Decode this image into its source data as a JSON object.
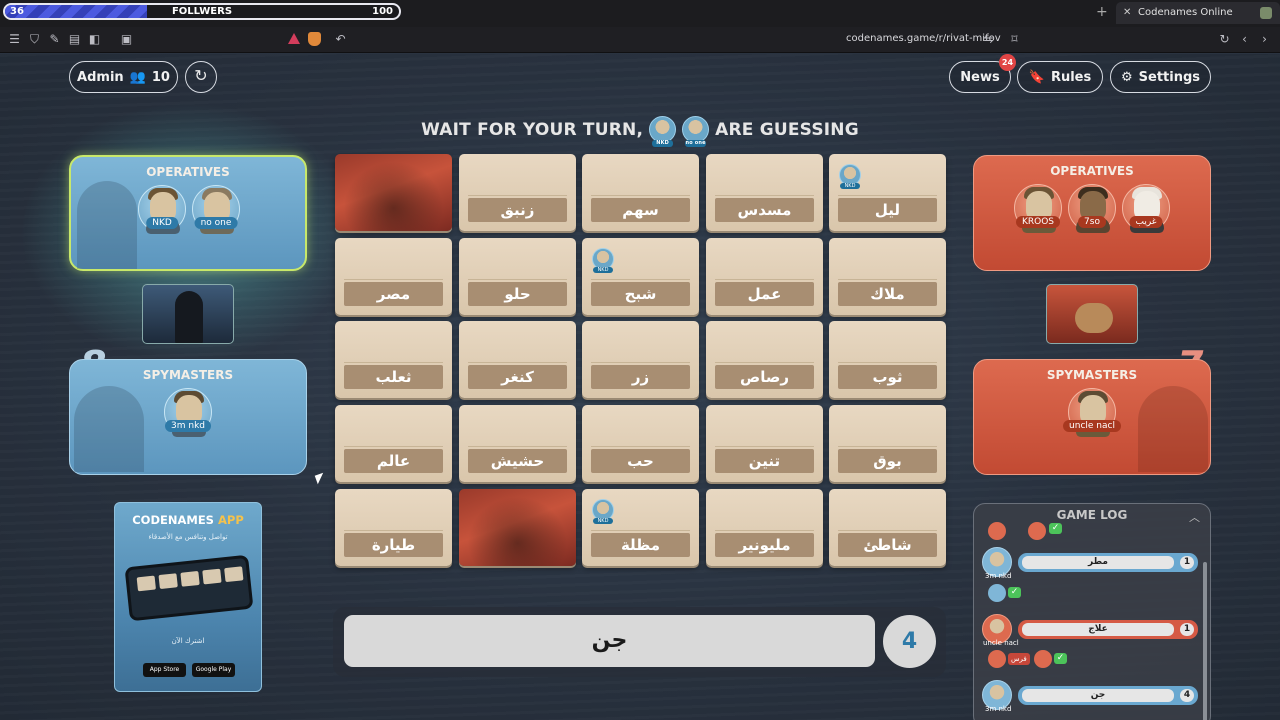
{
  "stream": {
    "followers_current": "36",
    "followers_label": "FOLLWERS",
    "followers_goal": "100",
    "progress_fraction": 0.36
  },
  "browser": {
    "tab_title": "Codenames Online",
    "url": "codenames.game/r/rivat-mifov"
  },
  "header": {
    "admin_label": "Admin",
    "player_count": "10",
    "news_label": "News",
    "news_badge": "24",
    "rules_label": "Rules",
    "settings_label": "Settings"
  },
  "banner": {
    "prefix": "WAIT FOR YOUR TURN,",
    "suffix": "ARE GUESSING",
    "guessers": [
      "NKD",
      "no one"
    ]
  },
  "blue_team": {
    "score": "8",
    "operatives_title": "OPERATIVES",
    "operatives": [
      "NKD",
      "no one"
    ],
    "spymasters_title": "SPYMASTERS",
    "spymasters": [
      "3m nkd"
    ]
  },
  "red_team": {
    "score": "7",
    "operatives_title": "OPERATIVES",
    "operatives": [
      "KROOS",
      "7so",
      "غريب"
    ],
    "spymasters_title": "SPYMASTERS",
    "spymasters": [
      "uncle nacl"
    ]
  },
  "board": {
    "cards": [
      {
        "word": "",
        "revealed": "red",
        "marker": ""
      },
      {
        "word": "زنبق",
        "revealed": "",
        "marker": ""
      },
      {
        "word": "سهم",
        "revealed": "",
        "marker": ""
      },
      {
        "word": "مسدس",
        "revealed": "",
        "marker": ""
      },
      {
        "word": "ليل",
        "revealed": "",
        "marker": "NKD"
      },
      {
        "word": "مصر",
        "revealed": "",
        "marker": ""
      },
      {
        "word": "حلو",
        "revealed": "",
        "marker": ""
      },
      {
        "word": "شبح",
        "revealed": "",
        "marker": "NKD"
      },
      {
        "word": "عمل",
        "revealed": "",
        "marker": ""
      },
      {
        "word": "ملاك",
        "revealed": "",
        "marker": ""
      },
      {
        "word": "ثعلب",
        "revealed": "",
        "marker": ""
      },
      {
        "word": "كنغر",
        "revealed": "",
        "marker": ""
      },
      {
        "word": "زر",
        "revealed": "",
        "marker": ""
      },
      {
        "word": "رصاص",
        "revealed": "",
        "marker": ""
      },
      {
        "word": "ثوب",
        "revealed": "",
        "marker": ""
      },
      {
        "word": "عالم",
        "revealed": "",
        "marker": ""
      },
      {
        "word": "حشيش",
        "revealed": "",
        "marker": ""
      },
      {
        "word": "حب",
        "revealed": "",
        "marker": ""
      },
      {
        "word": "تنين",
        "revealed": "",
        "marker": ""
      },
      {
        "word": "بوق",
        "revealed": "",
        "marker": ""
      },
      {
        "word": "طيارة",
        "revealed": "",
        "marker": ""
      },
      {
        "word": "",
        "revealed": "red",
        "marker": ""
      },
      {
        "word": "مظلة",
        "revealed": "",
        "marker": "NKD"
      },
      {
        "word": "مليونير",
        "revealed": "",
        "marker": ""
      },
      {
        "word": "شاطئ",
        "revealed": "",
        "marker": ""
      }
    ]
  },
  "clue": {
    "word": "جن",
    "number": "4"
  },
  "promo": {
    "title_main": "CODENAMES",
    "title_accent": "APP",
    "subtitle": "تواصل وتنافس مع الأصدقاء",
    "cta": "اشترك الآن",
    "app_store": "App Store",
    "google_play": "Google Play"
  },
  "game_log": {
    "title": "GAME LOG",
    "entries": [
      {
        "team": "blue",
        "player": "3m nkd",
        "clue": "مطر",
        "number": "1"
      },
      {
        "team": "red",
        "player": "uncle nacl",
        "clue": "علاج",
        "number": "1"
      },
      {
        "team": "blue",
        "player": "3m nkd",
        "clue": "جن",
        "number": "4"
      }
    ],
    "guess_tag": "فرس"
  },
  "colors": {
    "blue_team": "#7fb6d7",
    "red_team": "#dd6a4f",
    "card": "#e8d8c2",
    "word_bar": "#a88e72"
  }
}
